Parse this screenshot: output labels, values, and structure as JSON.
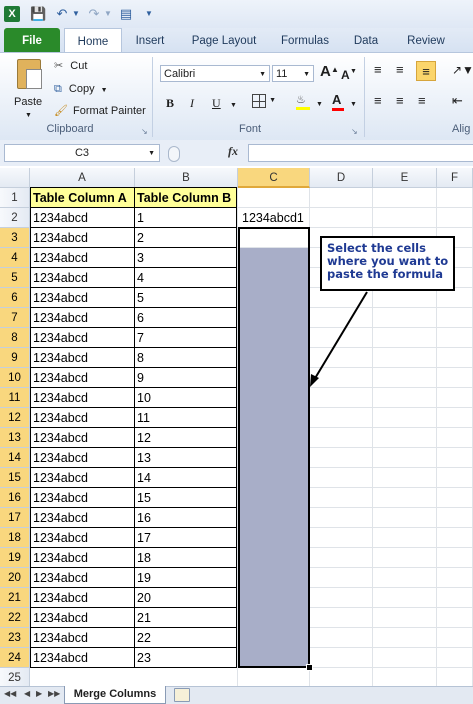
{
  "qat": {
    "undo_icon": "undo-icon",
    "redo_icon": "redo-icon"
  },
  "tabs": [
    "File",
    "Home",
    "Insert",
    "Page Layout",
    "Formulas",
    "Data",
    "Review"
  ],
  "clipboard": {
    "paste": "Paste",
    "cut": "Cut",
    "copy": "Copy",
    "format_painter": "Format Painter",
    "group": "Clipboard"
  },
  "font": {
    "name": "Calibri",
    "size": "11",
    "group": "Font",
    "grow": "A",
    "shrink": "A",
    "bold": "B",
    "italic": "I",
    "underline": "U",
    "color_letter": "A"
  },
  "align": {
    "group": "Alig"
  },
  "formula_bar": {
    "name_box": "C3",
    "fx": "fx",
    "formula": ""
  },
  "columns": [
    "A",
    "B",
    "C",
    "D",
    "E",
    "F"
  ],
  "rows": [
    "1",
    "2",
    "3",
    "4",
    "5",
    "6",
    "7",
    "8",
    "9",
    "10",
    "11",
    "12",
    "13",
    "14",
    "15",
    "16",
    "17",
    "18",
    "19",
    "20",
    "21",
    "22",
    "23",
    "24",
    "25"
  ],
  "col_a": [
    "Table Column A",
    "1234abcd",
    "1234abcd",
    "1234abcd",
    "1234abcd",
    "1234abcd",
    "1234abcd",
    "1234abcd",
    "1234abcd",
    "1234abcd",
    "1234abcd",
    "1234abcd",
    "1234abcd",
    "1234abcd",
    "1234abcd",
    "1234abcd",
    "1234abcd",
    "1234abcd",
    "1234abcd",
    "1234abcd",
    "1234abcd",
    "1234abcd",
    "1234abcd",
    "1234abcd"
  ],
  "col_b": [
    "Table Column B",
    "1",
    "2",
    "3",
    "4",
    "5",
    "6",
    "7",
    "8",
    "9",
    "10",
    "11",
    "12",
    "13",
    "14",
    "15",
    "16",
    "17",
    "18",
    "19",
    "20",
    "21",
    "22",
    "23"
  ],
  "c2": "1234abcd1",
  "callout": "Select the cells where you want to paste the formula",
  "sheet_tab": "Merge Columns",
  "colors": {
    "header_fill": "#ffff99",
    "selection": "#a8aec8",
    "selected_row_header": "#f9d77e",
    "file_tab": "#2a8a2a",
    "callout_text": "#1f3a93"
  }
}
